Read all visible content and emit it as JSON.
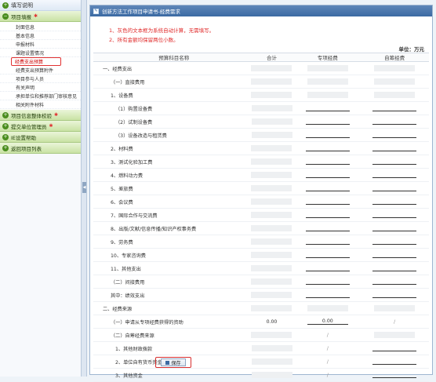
{
  "sidebar": {
    "top": "填写说明",
    "group1": "项目填报",
    "group1_items": [
      "封面信息",
      "基本信息",
      "申报材料",
      "课题设置情况",
      "经费支出预算",
      "经费支出预算附件",
      "项目参与人员",
      "有关声明",
      "承担单位和推荐部门审核意见",
      "相关附件材料"
    ],
    "group2": "项目信息整体校验",
    "group3": "提交单位管理员",
    "group4": "IE设置帮助",
    "group5": "返回项目列表"
  },
  "main": {
    "title": "创新方法工作项目申请书-经费需求",
    "notes": [
      "1、灰色的文本框为系统自动计算，无需填写。",
      "2、所有金额均保留两位小数。"
    ],
    "unit": "单位：万元",
    "headers": [
      "预算科目名称",
      "合计",
      "专项经费",
      "自筹经费"
    ],
    "rows": [
      {
        "name": "一、经费支出",
        "level": 0,
        "c2": "g",
        "c3": "g",
        "c4": "g"
      },
      {
        "name": "（一）直接费用",
        "level": 1,
        "c2": "g",
        "c3": "g",
        "c4": "g"
      },
      {
        "name": "1、设备费",
        "level": 1,
        "c2": "g",
        "c3": "g",
        "c4": "g"
      },
      {
        "name": "（1）购置设备费",
        "level": 2,
        "c2": "g",
        "c3": "l",
        "c4": "l"
      },
      {
        "name": "（2）试制设备费",
        "level": 2,
        "c2": "g",
        "c3": "l",
        "c4": "l"
      },
      {
        "name": "（3）设备改造与租赁费",
        "level": 2,
        "c2": "g",
        "c3": "l",
        "c4": "l"
      },
      {
        "name": "2、材料费",
        "level": 1,
        "c2": "g",
        "c3": "l",
        "c4": "l"
      },
      {
        "name": "3、测试化验加工费",
        "level": 1,
        "c2": "g",
        "c3": "l",
        "c4": "l"
      },
      {
        "name": "4、燃料动力费",
        "level": 1,
        "c2": "g",
        "c3": "l",
        "c4": "l"
      },
      {
        "name": "5、差旅费",
        "level": 1,
        "c2": "g",
        "c3": "l",
        "c4": "l"
      },
      {
        "name": "6、会议费",
        "level": 1,
        "c2": "g",
        "c3": "l",
        "c4": "l"
      },
      {
        "name": "7、国际合作与交流费",
        "level": 1,
        "c2": "g",
        "c3": "l",
        "c4": "l"
      },
      {
        "name": "8、出版/文献/信息传播/知识产权事务费",
        "level": 1,
        "c2": "g",
        "c3": "l",
        "c4": "l"
      },
      {
        "name": "9、劳务费",
        "level": 1,
        "c2": "g",
        "c3": "l",
        "c4": "l"
      },
      {
        "name": "10、专家咨询费",
        "level": 1,
        "c2": "g",
        "c3": "l",
        "c4": "l"
      },
      {
        "name": "11、其他支出",
        "level": 1,
        "c2": "g",
        "c3": "l",
        "c4": "l"
      },
      {
        "name": "（二）间接费用",
        "level": 1,
        "c2": "g",
        "c3": "l",
        "c4": "l"
      },
      {
        "name": "其中：绩效支出",
        "level": 1,
        "c2": "g",
        "c3": "l",
        "c4": "l"
      },
      {
        "name": "二、经费来源",
        "level": 0,
        "c2": "g",
        "c3": "g",
        "c4": "g"
      },
      {
        "name": "（一）申请从专项经费获得的资助",
        "level": 1,
        "c2": "0.00",
        "c3": "0.00",
        "c4": "/"
      },
      {
        "name": "（二）自筹经费来源",
        "level": 1,
        "c2": "g",
        "c3": "/",
        "c4": "g"
      },
      {
        "name": "1、其他财政拨款",
        "level": 2,
        "c2": "g",
        "c3": "/",
        "c4": "l"
      },
      {
        "name": "2、单位自有货币资金",
        "level": 2,
        "c2": "g",
        "c3": "/",
        "c4": "l"
      },
      {
        "name": "3、其他资金",
        "level": 2,
        "c2": "g",
        "c3": "/",
        "c4": "l"
      }
    ],
    "save_label": "保存"
  }
}
